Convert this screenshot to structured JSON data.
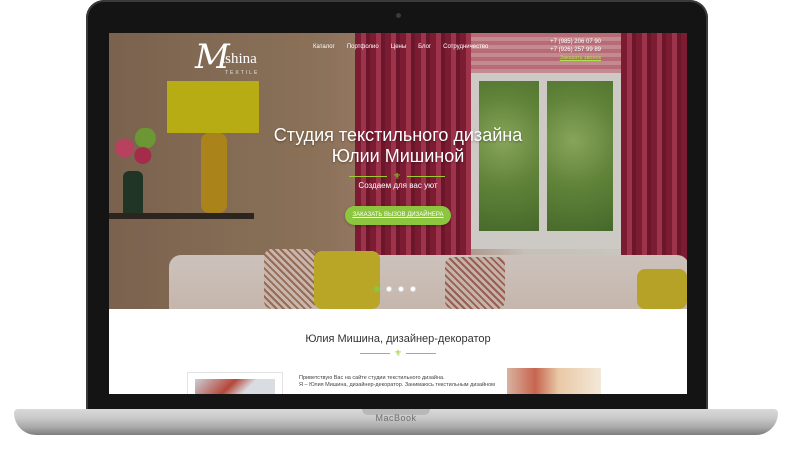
{
  "device": {
    "brand": "MacBook"
  },
  "header": {
    "logo": {
      "letter": "M",
      "text": "ishina",
      "subtitle": "TEXTILE"
    },
    "nav": [
      "Каталог",
      "Портфолио",
      "Цены",
      "Блог",
      "Сотрудничество"
    ],
    "phones": [
      "+7 (985) 206 07 90",
      "+7 (926) 257 99 89"
    ],
    "callback_label": "Заказать звонок"
  },
  "hero": {
    "title_line1": "Студия текстильного дизайна",
    "title_line2": "Юлии Мишиной",
    "subtitle": "Создаем для вас уют",
    "cta_label": "Заказать вызов дизайнера",
    "slides_total": 4,
    "slide_active": 1
  },
  "about": {
    "title": "Юлия Мишина, дизайнер-декоратор",
    "bio_line1": "Приветствую Вас на сайте студии текстильного дизайна.",
    "bio_line2": "Я – Юлия Мишина, дизайнер-декоратор. Занимаюсь текстильным дизайном"
  },
  "colors": {
    "accent": "#8cc63f",
    "link": "#b3e04a"
  },
  "icons": {
    "divider": "fleur-de-lis-icon",
    "camera": "camera-icon"
  }
}
